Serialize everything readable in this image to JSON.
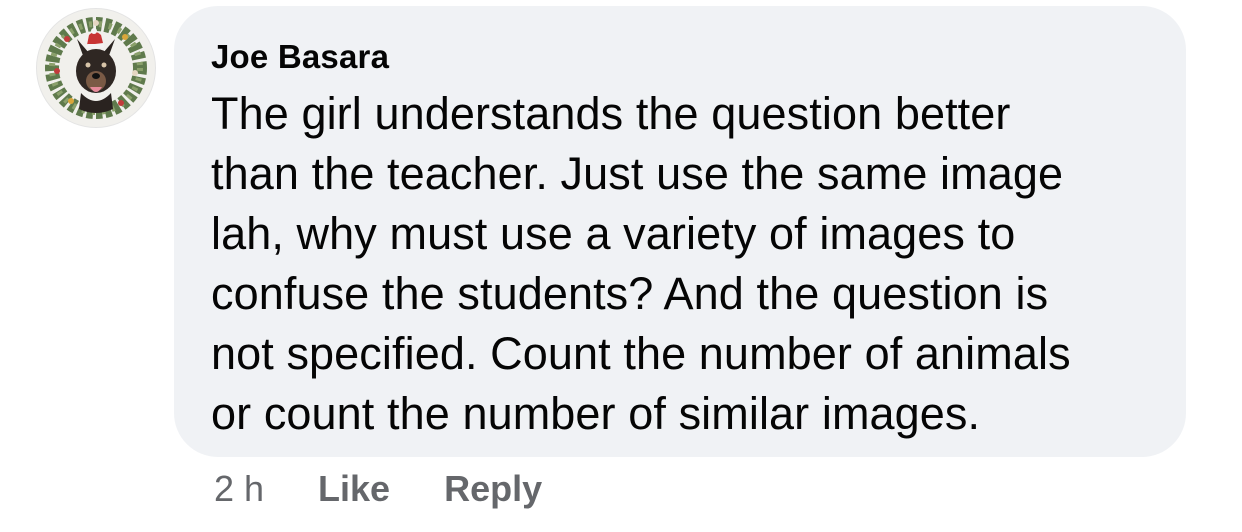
{
  "comment": {
    "author": "Joe Basara",
    "avatar_icon": "dog-wreath-avatar-icon",
    "text": "The girl understands the question better\nthan the teacher. Just use the same image\nlah, why must use a variety of images to\nconfuse the students? And the question is\nnot specified. Count the number of animals\nor count the number of similar images.",
    "bubble_color": "#f0f2f5"
  },
  "actions": {
    "timestamp": "2 h",
    "like_label": "Like",
    "reply_label": "Reply",
    "action_color": "#65676b"
  }
}
